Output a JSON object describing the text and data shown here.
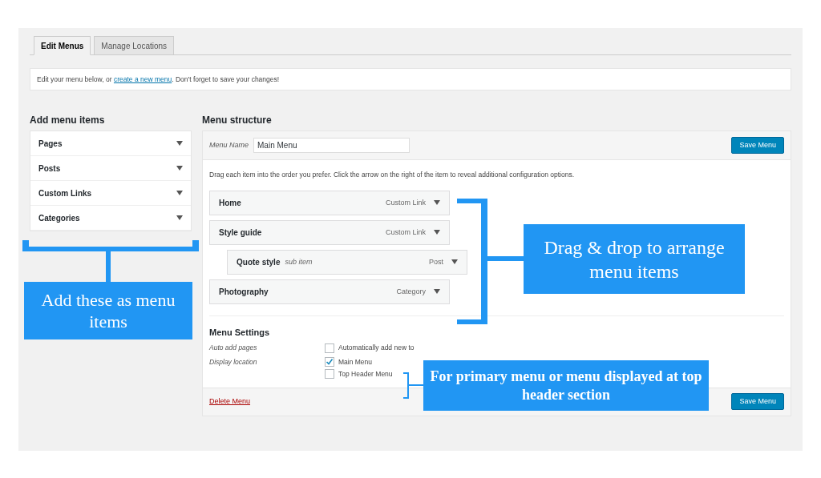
{
  "tabs": [
    {
      "label": "Edit Menus",
      "selected": true
    },
    {
      "label": "Manage Locations",
      "selected": false
    }
  ],
  "notice": {
    "before": "Edit your menu below, or ",
    "link": "create a new menu",
    "after": ". Don't forget to save your changes!"
  },
  "add_menu_items": {
    "heading": "Add menu items",
    "sections": [
      {
        "label": "Pages"
      },
      {
        "label": "Posts"
      },
      {
        "label": "Custom Links"
      },
      {
        "label": "Categories"
      }
    ]
  },
  "menu_structure": {
    "heading": "Menu structure",
    "name_label": "Menu Name",
    "name_value": "Main Menu",
    "save_button": "Save Menu",
    "instructions": "Drag each item into the order you prefer. Click the arrow on the right of the item to reveal additional configuration options.",
    "items": [
      {
        "title": "Home",
        "type": "Custom Link"
      },
      {
        "title": "Style guide",
        "type": "Custom Link",
        "children": [
          {
            "title": "Quote style",
            "sub_label": "sub item",
            "type": "Post"
          }
        ]
      },
      {
        "title": "Photography",
        "type": "Category"
      }
    ],
    "settings": {
      "heading": "Menu Settings",
      "rows": [
        {
          "label": "Auto add pages",
          "options": [
            {
              "label": "Automatically add new to",
              "checked": false
            }
          ]
        },
        {
          "label": "Display location",
          "options": [
            {
              "label": "Main Menu",
              "checked": true
            },
            {
              "label": "Top Header Menu",
              "checked": false
            }
          ]
        }
      ]
    },
    "delete_link": "Delete Menu",
    "footer_save_button": "Save Menu"
  },
  "callouts": [
    {
      "text": "Add these as menu items"
    },
    {
      "text": "Drag & drop to arrange menu items"
    },
    {
      "text": "For primary menu or menu displayed at top header section"
    }
  ]
}
